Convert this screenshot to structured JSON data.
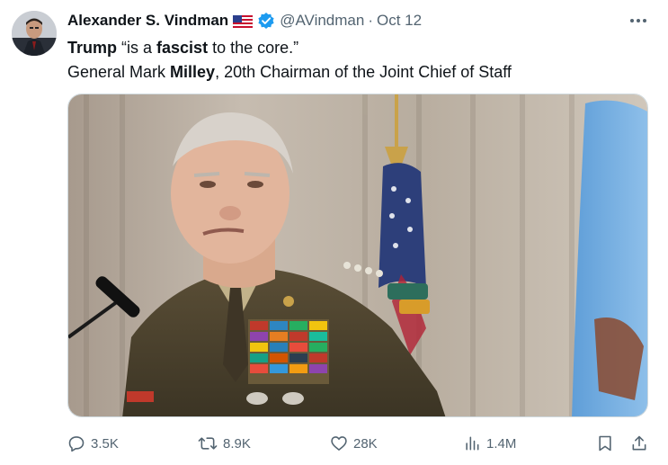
{
  "author": {
    "display_name": "Alexander S. Vindman",
    "handle": "@AVindman",
    "separator": "·",
    "date": "Oct 12",
    "flag_icon": "us-flag-icon",
    "verified_icon": "verified-badge-icon",
    "verified_color": "#1d9bf0"
  },
  "tweet": {
    "line1": {
      "part1": "Trump",
      "part2": " “is a ",
      "part3": "fascist",
      "part4": " to the core.”"
    },
    "line2": {
      "part1": "General Mark ",
      "part2": "Milley",
      "part3": ", 20th Chairman of the Joint Chief of Staff"
    }
  },
  "media": {
    "kind": "photo"
  },
  "actions": {
    "reply_count": "3.5K",
    "retweet_count": "8.9K",
    "like_count": "28K",
    "views_count": "1.4M"
  },
  "colors": {
    "text_primary": "#0f1419",
    "text_secondary": "#536471",
    "border": "#cfd9de"
  }
}
